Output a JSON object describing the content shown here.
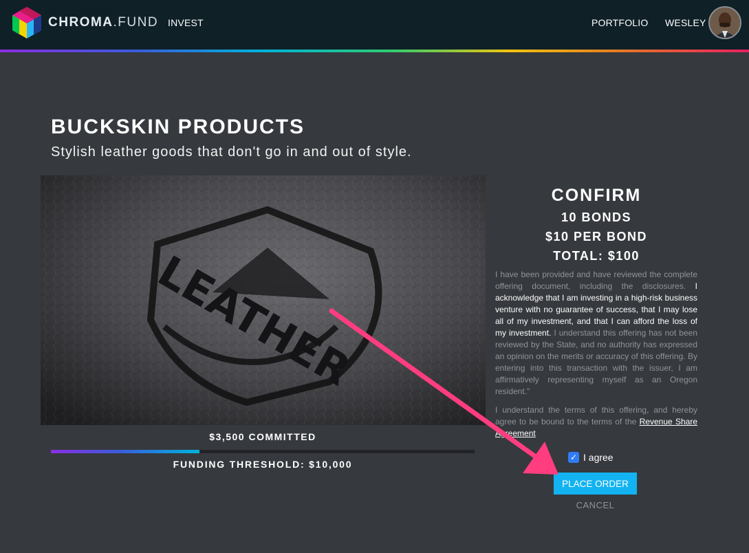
{
  "nav": {
    "brand_prefix": "CHROMA",
    "brand_suffix": ".FUND",
    "invest_label": "INVEST",
    "portfolio_label": "PORTFOLIO",
    "user_label": "WESLEY"
  },
  "offering": {
    "title": "BUCKSKIN PRODUCTS",
    "subtitle": "Stylish leather goods that don't go in and out of style.",
    "image_text": "LEATHER",
    "committed_label": "$3,500 COMMITTED",
    "progress_fraction": 0.35,
    "threshold_label": "FUNDING THRESHOLD: $10,000"
  },
  "confirm": {
    "title": "CONFIRM",
    "bonds": "10 BONDS",
    "per_bond": "$10 PER BOND",
    "total": "TOTAL: $100",
    "legal_part1": "I have been provided and have reviewed the complete offering document, including the disclosures.",
    "legal_bold": "I acknowledge that I am investing in a high-risk business venture with no guarantee of success, that I may lose all of my investment, and that I can afford the loss of my investment.",
    "legal_part2": "I understand this offering has not been reviewed by the State, and no authority has expressed an opinion on the merits or accuracy of this offering. By entering into this transaction with the issuer, I am affirmatively representing myself as an Oregon resident.\"",
    "terms_text": "I understand the terms of this offering, and hereby agree to be bound to the terms of the",
    "terms_link": "Revenue Share Agreement",
    "agree_label": "I agree",
    "agree_checked": true,
    "place_order_label": "PLACE ORDER",
    "cancel_label": "CANCEL"
  },
  "colors": {
    "navbar": "#0f2027",
    "background": "#36393e",
    "accent_button": "#12b3f0",
    "annotation_arrow": "#ff3d7f"
  }
}
